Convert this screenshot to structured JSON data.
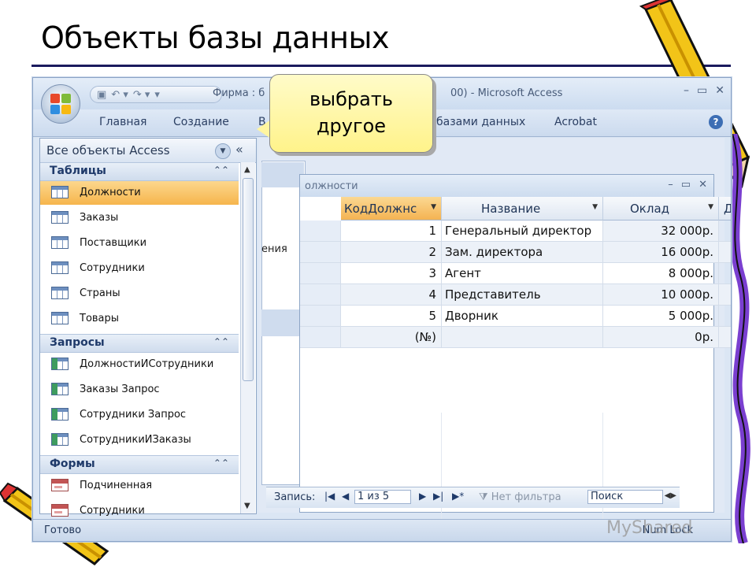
{
  "slide": {
    "title": "Объекты базы данных"
  },
  "window": {
    "title_left": "Фирма : б",
    "title_right": "00) - Microsoft Access",
    "ribbon_tabs": [
      "Главная",
      "Создание",
      "В",
      "базами данных",
      "Acrobat"
    ],
    "controls": [
      "–",
      "▭",
      "✕"
    ]
  },
  "nav": {
    "header": "Все объекты Access",
    "groups": [
      {
        "label": "Таблицы",
        "items": [
          "Должности",
          "Заказы",
          "Поставщики",
          "Сотрудники",
          "Страны",
          "Товары"
        ],
        "selected": "Должности"
      },
      {
        "label": "Запросы",
        "items": [
          "ДолжностиИСотрудники",
          "Заказы Запрос",
          "Сотрудники Запрос",
          "СотрудникиИЗаказы"
        ]
      },
      {
        "label": "Формы",
        "items": [
          "Подчиненная",
          "Сотрудники"
        ]
      }
    ]
  },
  "background": {
    "ghost_text": "ения"
  },
  "datasheet": {
    "title": "олжности",
    "columns": [
      "КодДолжнс",
      "Название",
      "Оклад",
      "Д"
    ],
    "rows": [
      {
        "id": "1",
        "name": "Генеральный директор",
        "salary": "32 000р."
      },
      {
        "id": "2",
        "name": "Зам. директора",
        "salary": "16 000р."
      },
      {
        "id": "3",
        "name": "Агент",
        "salary": "8 000р."
      },
      {
        "id": "4",
        "name": "Представитель",
        "salary": "10 000р."
      },
      {
        "id": "5",
        "name": "Дворник",
        "salary": "5 000р."
      }
    ],
    "new_row": {
      "id": "(№)",
      "salary": "0р."
    }
  },
  "record_nav": {
    "label": "Запись:",
    "position": "1 из 5",
    "filter": "Нет фильтра",
    "search": "Поиск"
  },
  "status": {
    "left": "Готово",
    "right": "Num Lock"
  },
  "callout": {
    "line1": "выбрать",
    "line2": "другое"
  },
  "watermark": "MyShared"
}
